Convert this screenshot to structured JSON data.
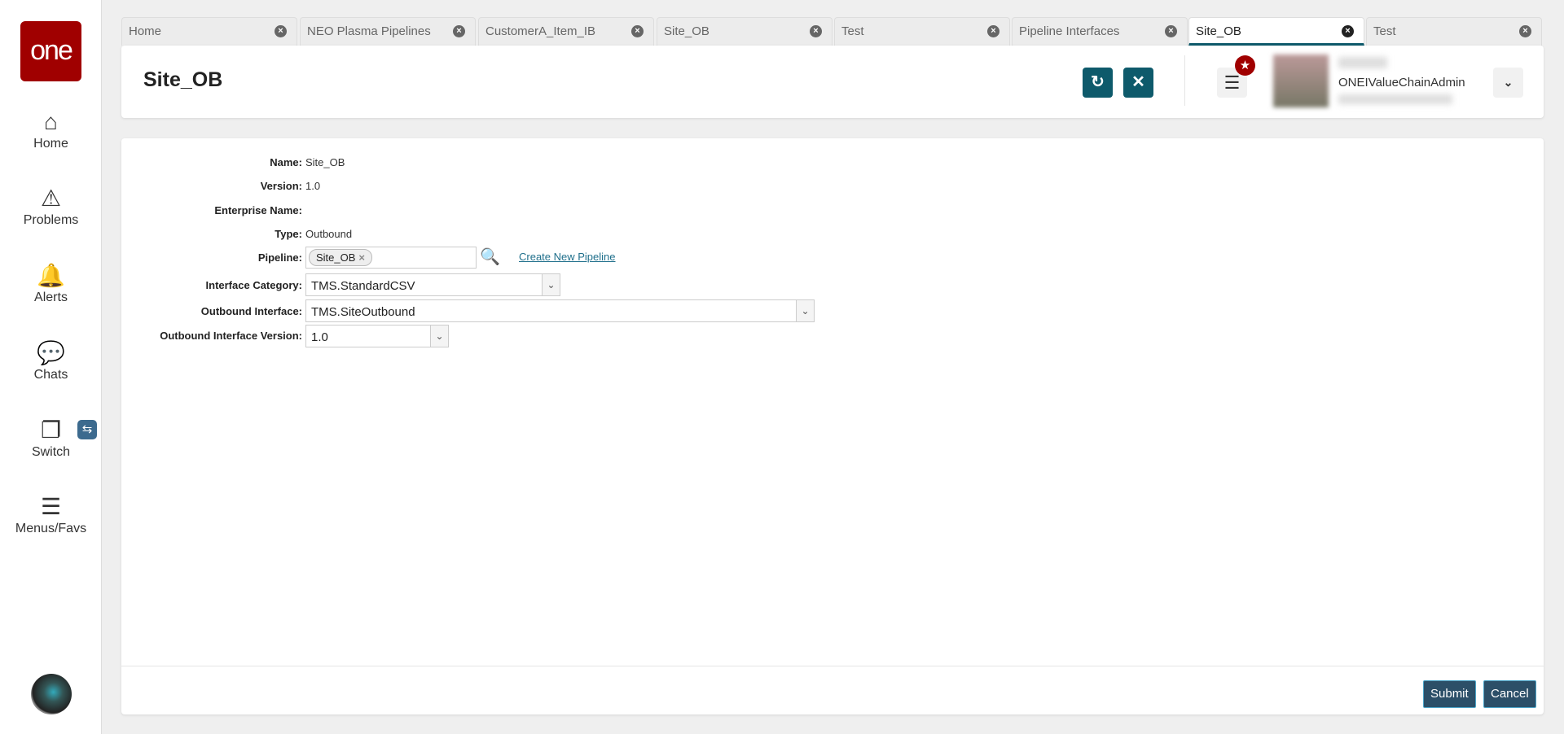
{
  "sidebar": {
    "logo": "one",
    "items": [
      {
        "label": "Home"
      },
      {
        "label": "Problems"
      },
      {
        "label": "Alerts"
      },
      {
        "label": "Chats"
      },
      {
        "label": "Switch"
      },
      {
        "label": "Menus/Favs"
      }
    ]
  },
  "tabs": [
    {
      "label": "Home"
    },
    {
      "label": "NEO Plasma Pipelines"
    },
    {
      "label": "CustomerA_Item_IB"
    },
    {
      "label": "Site_OB"
    },
    {
      "label": "Test"
    },
    {
      "label": "Pipeline Interfaces"
    },
    {
      "label": "Site_OB",
      "active": true
    },
    {
      "label": "Test"
    }
  ],
  "header": {
    "title": "Site_OB",
    "user_role": "ONEIValueChainAdmin"
  },
  "form": {
    "name_label": "Name:",
    "name": "Site_OB",
    "version_label": "Version:",
    "version": "1.0",
    "enterprise_label": "Enterprise Name:",
    "enterprise": "",
    "type_label": "Type:",
    "type": "Outbound",
    "pipeline_label": "Pipeline:",
    "pipeline_chip": "Site_OB",
    "create_pipeline": "Create New Pipeline",
    "category_label": "Interface Category:",
    "category": "TMS.StandardCSV",
    "outbound_label": "Outbound Interface:",
    "outbound": "TMS.SiteOutbound",
    "outbound_version_label": "Outbound Interface Version:",
    "outbound_version": "1.0"
  },
  "footer": {
    "submit": "Submit",
    "cancel": "Cancel"
  },
  "colors": {
    "brand": "#a00000",
    "accent": "#0e5a6b",
    "button": "#2c4f68"
  }
}
